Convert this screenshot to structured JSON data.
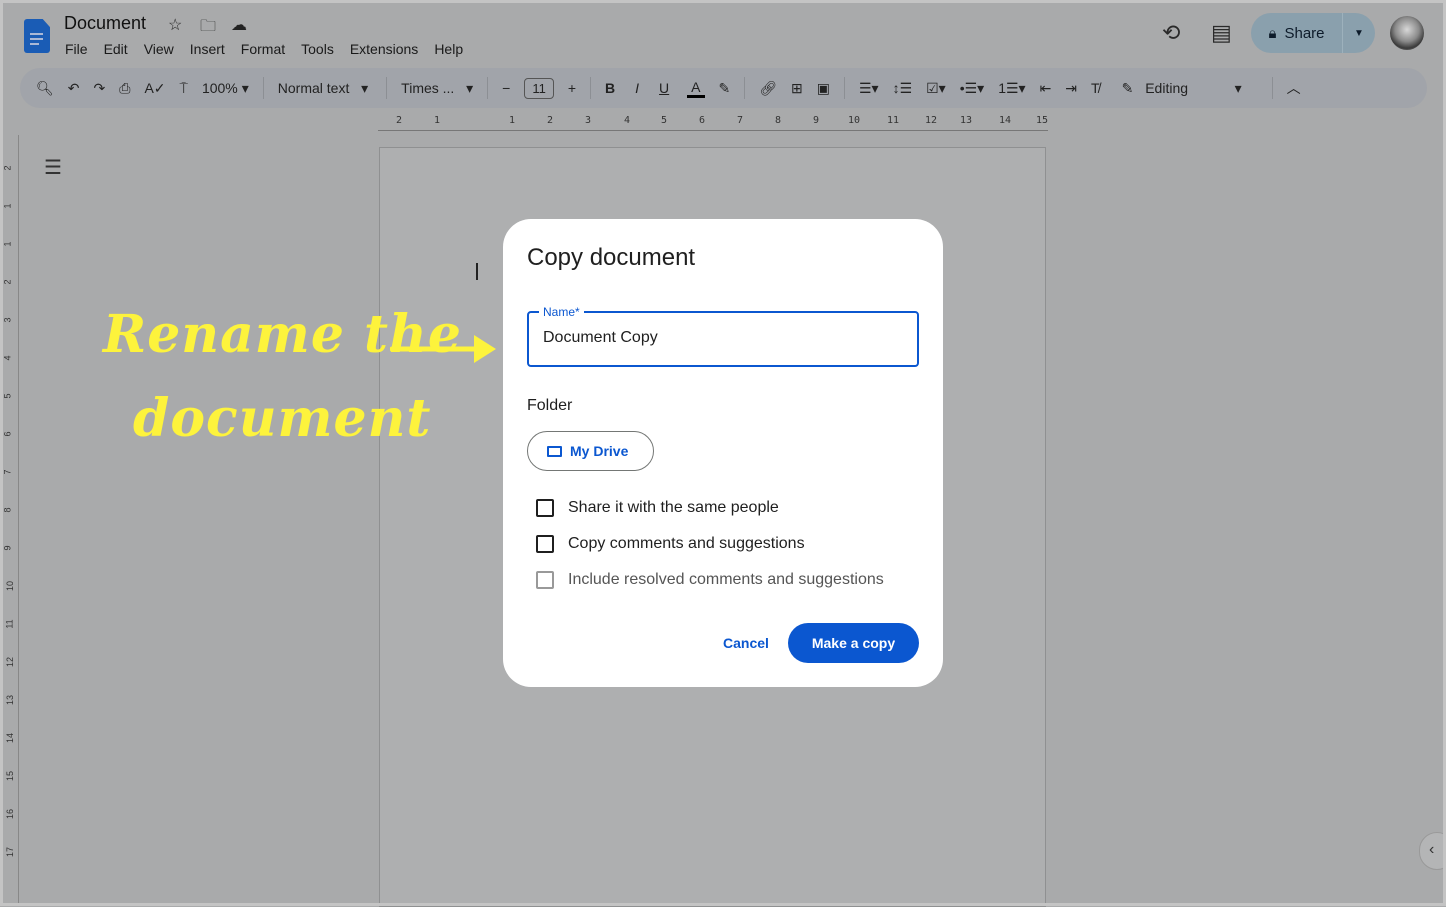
{
  "app": {
    "title": "Document",
    "menu": [
      "File",
      "Edit",
      "View",
      "Insert",
      "Format",
      "Tools",
      "Extensions",
      "Help"
    ],
    "share_label": "Share",
    "icons": [
      "docs-logo-icon",
      "star-icon",
      "move-folder-icon",
      "cloud-saved-icon",
      "history-icon",
      "comments-icon",
      "lock-icon",
      "avatar"
    ]
  },
  "toolbar": {
    "zoom": "100%",
    "style": "Normal text",
    "font": "Times ...",
    "font_size": "11",
    "minus": "−",
    "plus": "+",
    "bold": "B",
    "italic": "I",
    "underline": "U",
    "text_color": "A",
    "mode": "Editing"
  },
  "ruler": {
    "h": [
      "2",
      "1",
      "1",
      "2",
      "3",
      "4",
      "5",
      "6",
      "7",
      "8",
      "9",
      "10",
      "11",
      "12",
      "13",
      "14",
      "15"
    ],
    "v": [
      "2",
      "1",
      "1",
      "2",
      "3",
      "4",
      "5",
      "6",
      "7",
      "8",
      "9",
      "10",
      "11",
      "12",
      "13",
      "14",
      "15",
      "16",
      "17"
    ]
  },
  "annotation": {
    "line1": "Rename the",
    "line2": "document",
    "color": "#fdf33c"
  },
  "dialog": {
    "title": "Copy document",
    "name_label": "Name*",
    "name_value": "Document Copy",
    "folder_label": "Folder",
    "folder_button": "My Drive",
    "checkboxes": [
      {
        "label": "Share it with the same people",
        "checked": false,
        "enabled": true
      },
      {
        "label": "Copy comments and suggestions",
        "checked": false,
        "enabled": true
      },
      {
        "label": "Include resolved comments and suggestions",
        "checked": false,
        "enabled": false
      }
    ],
    "cancel": "Cancel",
    "confirm": "Make a copy",
    "accent": "#0b57d0"
  }
}
